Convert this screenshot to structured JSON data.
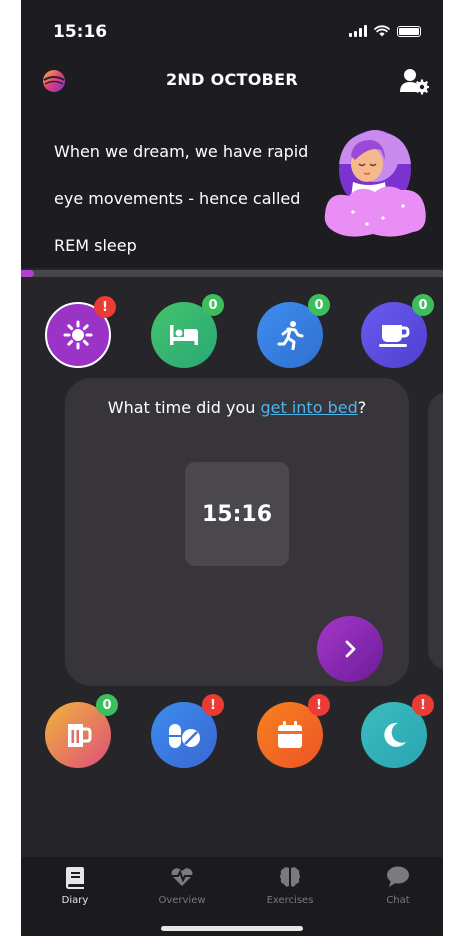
{
  "status_bar": {
    "time": "15:16"
  },
  "header": {
    "title": "2ND OCTOBER"
  },
  "fact": {
    "lines": [
      "When we dream, we have rapid",
      "eye movements - hence called",
      "REM sleep"
    ]
  },
  "progress": {
    "fraction": 0.03
  },
  "categories_top": [
    {
      "name": "sun",
      "badge": "!",
      "badge_type": "alert"
    },
    {
      "name": "bed",
      "badge": "0",
      "badge_type": "count"
    },
    {
      "name": "exercise",
      "badge": "0",
      "badge_type": "count"
    },
    {
      "name": "coffee",
      "badge": "0",
      "badge_type": "count"
    }
  ],
  "question": {
    "prefix": "What time did you ",
    "link": "get into bed",
    "suffix": "?",
    "time_value": "15:16"
  },
  "categories_bottom": [
    {
      "name": "beer",
      "badge": "0",
      "badge_type": "count"
    },
    {
      "name": "pills",
      "badge": "!",
      "badge_type": "alert"
    },
    {
      "name": "calendar",
      "badge": "!",
      "badge_type": "alert"
    },
    {
      "name": "moon",
      "badge": "!",
      "badge_type": "alert"
    }
  ],
  "nav": {
    "items": [
      {
        "label": "Diary",
        "icon": "book-icon",
        "active": true
      },
      {
        "label": "Overview",
        "icon": "heartbeat-icon",
        "active": false
      },
      {
        "label": "Exercises",
        "icon": "brain-icon",
        "active": false
      },
      {
        "label": "Chat",
        "icon": "chat-icon",
        "active": false
      }
    ]
  },
  "colors": {
    "accent": "#a638c8",
    "link": "#4fb4ea",
    "badge_red": "#ea3b35",
    "badge_green": "#3dbe5c"
  }
}
